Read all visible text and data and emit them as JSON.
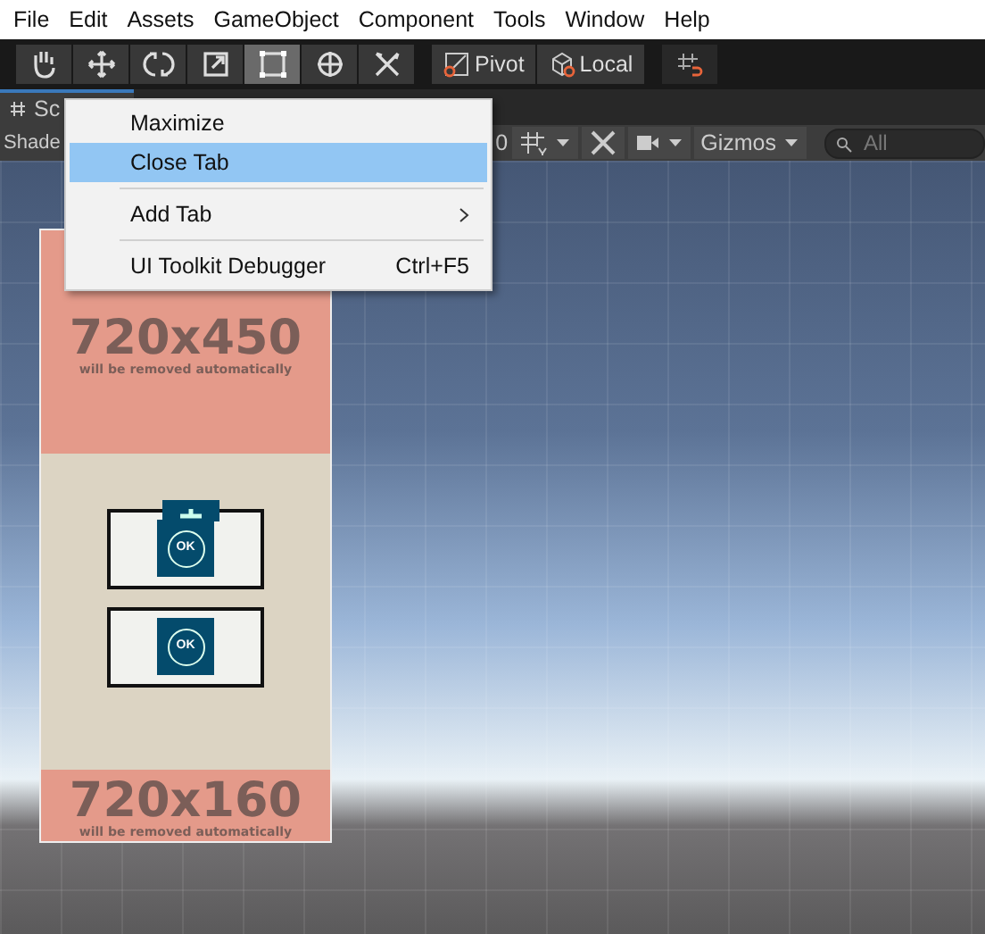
{
  "menu_bar": [
    "File",
    "Edit",
    "Assets",
    "GameObject",
    "Component",
    "Tools",
    "Window",
    "Help"
  ],
  "toolbar": {
    "tools": [
      {
        "kind": "hand",
        "selected": false
      },
      {
        "kind": "move",
        "selected": false
      },
      {
        "kind": "rotate",
        "selected": false
      },
      {
        "kind": "scale",
        "selected": false
      },
      {
        "kind": "rect",
        "selected": true
      },
      {
        "kind": "transform",
        "selected": false
      },
      {
        "kind": "custom",
        "selected": false
      }
    ],
    "pivot": "Pivot",
    "local": "Local"
  },
  "scene_tab": {
    "label": "Sc",
    "selected": true
  },
  "scene_toolbar": {
    "shading": "Shade",
    "scale": "0",
    "gizmos": "Gizmos",
    "search": {
      "placeholder": "All"
    }
  },
  "scene": {
    "top_banner": {
      "size": "720x450",
      "note": "will be removed automatically"
    },
    "buttons": [
      {
        "label": "OK",
        "anchor": true
      },
      {
        "label": "OK",
        "anchor": false
      }
    ],
    "bottom_banner": {
      "size": "720x160",
      "note": "will be removed automatically"
    }
  },
  "context_menu": {
    "items": [
      {
        "kind": "item",
        "label": "Maximize",
        "selected": false
      },
      {
        "kind": "item",
        "label": "Close Tab",
        "selected": true
      },
      {
        "kind": "separator"
      },
      {
        "kind": "submenu",
        "label": "Add Tab",
        "selected": false
      },
      {
        "kind": "separator"
      },
      {
        "kind": "item",
        "label": "UI Toolkit Debugger",
        "shortcut": "Ctrl+F5",
        "selected": false
      }
    ]
  }
}
